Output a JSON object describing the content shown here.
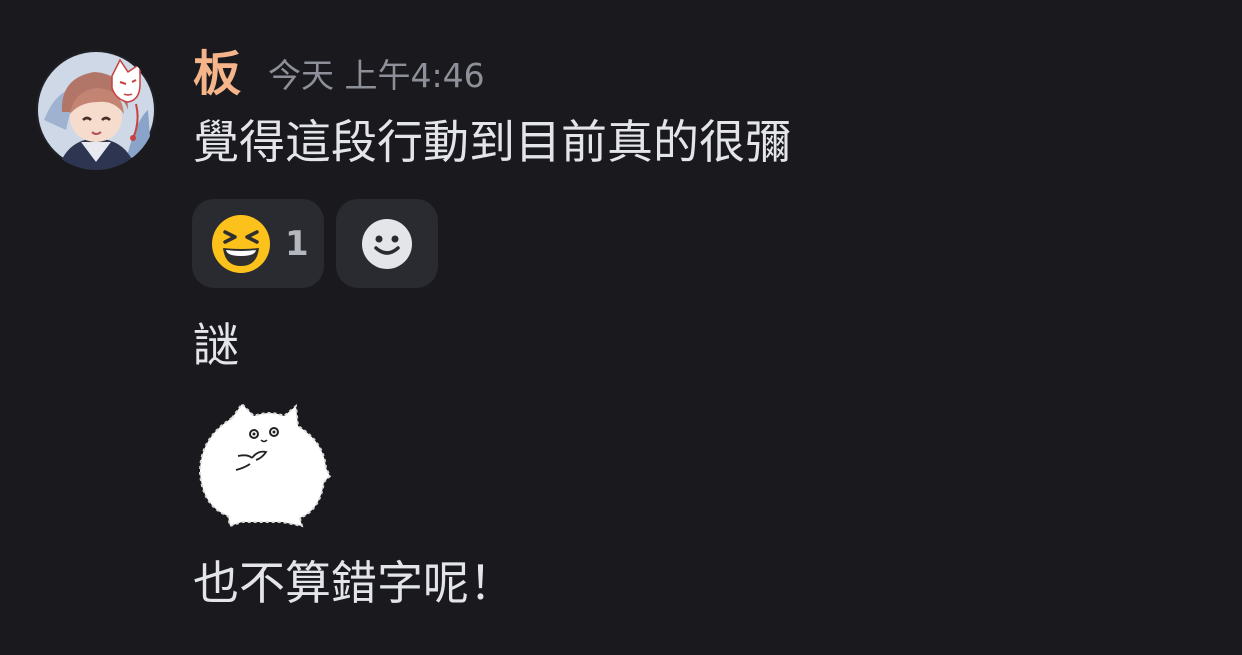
{
  "message": {
    "author": "板",
    "timestamp": "今天 上午4:46",
    "author_color": "#f6b48a",
    "avatar_icon": "anime-avatar",
    "lines": [
      "覺得這段行動到目前真的很彌",
      "謎",
      "也不算錯字呢！"
    ]
  },
  "reactions": [
    {
      "emoji": "laughing-face-emoji",
      "count": "1"
    }
  ],
  "add_reaction_icon": "smiley-add-reaction-icon",
  "sticker": "white-fluffy-cat-sticker",
  "colors": {
    "background": "#1a1a1e",
    "text": "#e3e5e8",
    "muted": "#8e9099",
    "reaction_bg": "#2a2b31"
  }
}
